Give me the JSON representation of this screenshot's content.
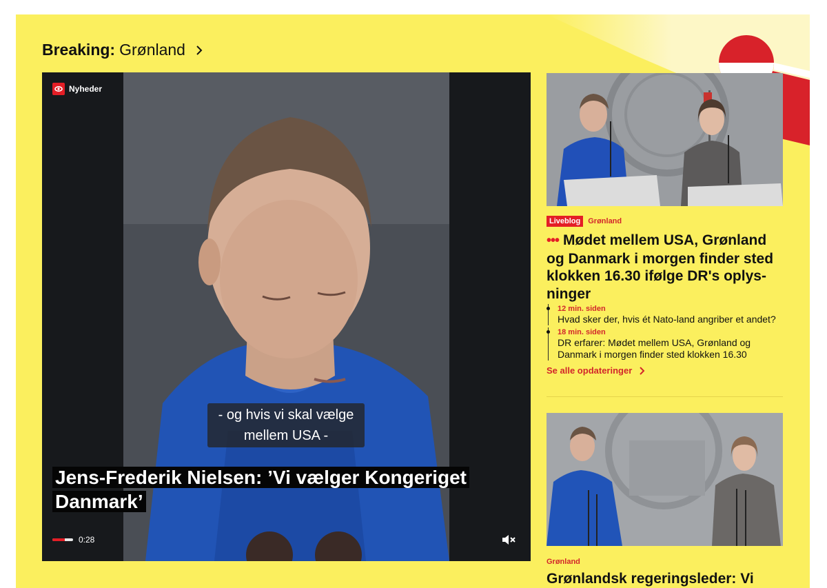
{
  "breaking": {
    "label": "Breaking:",
    "topic": "Grønland"
  },
  "video": {
    "channel": "Nyheder",
    "subtitle_line1": "- og hvis vi skal vælge",
    "subtitle_line2": "mellem USA -",
    "title_line1": "Jens-Frederik Nielsen: ’Vi vælger Kongeriget",
    "title_line2": "Danmark’",
    "time": "0:28",
    "progress_fraction": 0.6
  },
  "liveblog": {
    "tag": "Liveblog",
    "category": "Grønland",
    "headline": "Mødet mellem USA, Grønland og Danmark i morgen finder sted klokken 16.30 ifølge DR's oplys-ninger",
    "live_marker": "•••",
    "updates": [
      {
        "ago": "12 min. siden",
        "text": "Hvad sker der, hvis ét Nato-land angriber et andet?"
      },
      {
        "ago": "18 min. siden",
        "text": "DR erfarer: Mødet mellem USA, Grønland og Danmark i morgen finder sted klokken 16.30"
      }
    ],
    "see_all": "Se alle opdateringer"
  },
  "article2": {
    "category": "Grønland",
    "headline": "Grønlandsk regeringsleder: Vi"
  },
  "colors": {
    "panel": "#fbef5e",
    "accent_red": "#e41e26",
    "category_red": "#d2262b"
  },
  "icons": [
    "chevron-right-icon",
    "dr-logo-icon",
    "mute-icon"
  ]
}
